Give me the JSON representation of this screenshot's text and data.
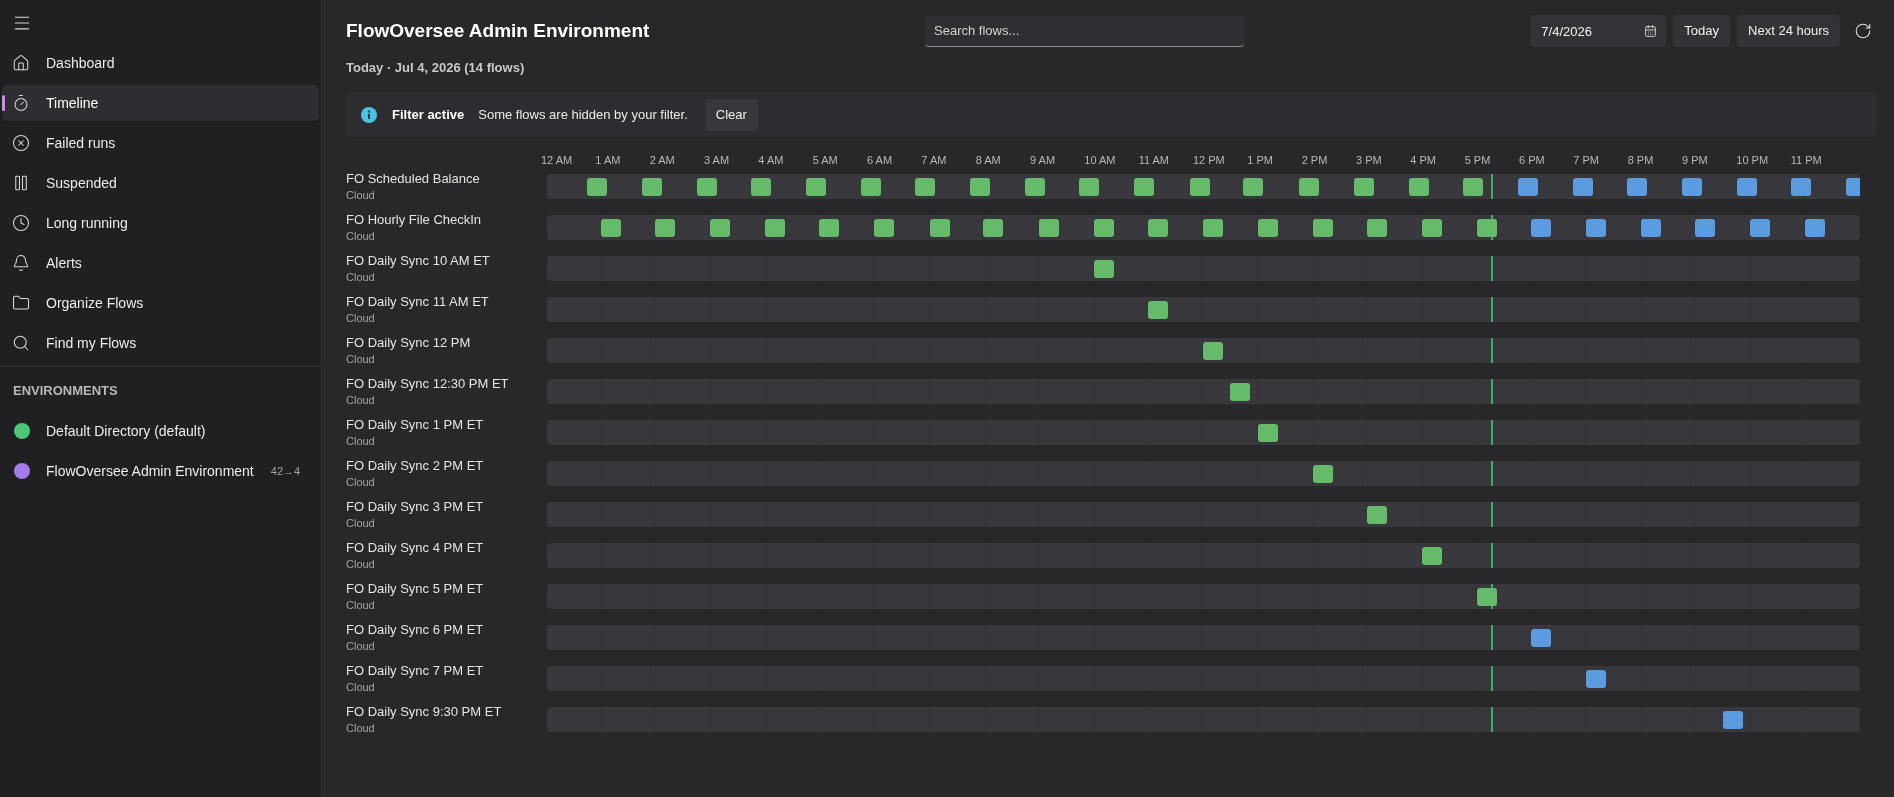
{
  "sidebar": {
    "nav_items": [
      {
        "label": "Dashboard",
        "selected": false
      },
      {
        "label": "Timeline",
        "selected": true
      },
      {
        "label": "Failed runs",
        "selected": false
      },
      {
        "label": "Suspended",
        "selected": false
      },
      {
        "label": "Long running",
        "selected": false
      },
      {
        "label": "Alerts",
        "selected": false
      },
      {
        "label": "Organize Flows",
        "selected": false
      },
      {
        "label": "Find my Flows",
        "selected": false
      }
    ],
    "section_title": "ENVIRONMENTS",
    "environments": [
      {
        "name": "Default Directory (default)",
        "color": "#4fc77a"
      },
      {
        "name": "FlowOversee Admin Environment",
        "color": "#a57bea",
        "badge": "42→4"
      }
    ]
  },
  "header": {
    "title": "FlowOversee Admin Environment",
    "search": {
      "placeholder": "Search flows..."
    },
    "date_field": {
      "value": "7/4/2026"
    },
    "buttons": [
      "Today",
      "Next 24 hours"
    ]
  },
  "subtitle": "Today · Jul 4, 2026 (14 flows)",
  "filter_banner": {
    "title": "Filter active",
    "message": "Some flows are hidden by your filter.",
    "button": "Clear"
  },
  "timeline": {
    "hours": [
      "12 AM",
      "1 AM",
      "2 AM",
      "3 AM",
      "4 AM",
      "5 AM",
      "6 AM",
      "7 AM",
      "8 AM",
      "9 AM",
      "10 AM",
      "11 AM",
      "12 PM",
      "1 PM",
      "2 PM",
      "3 PM",
      "4 PM",
      "5 PM",
      "6 PM",
      "7 PM",
      "8 PM",
      "9 PM",
      "10 PM",
      "11 PM"
    ],
    "now_line": {
      "level": 0.72
    },
    "flows": [
      {
        "name": "FO Scheduled Balance",
        "caption": "Cloud",
        "runs": [
          {
            "level": 0.038,
            "color": "#66bb6a"
          },
          {
            "level": 0.08,
            "color": "#66bb6a"
          },
          {
            "level": 0.122,
            "color": "#66bb6a"
          },
          {
            "level": 0.163,
            "color": "#66bb6a"
          },
          {
            "level": 0.205,
            "color": "#66bb6a"
          },
          {
            "level": 0.247,
            "color": "#66bb6a"
          },
          {
            "level": 0.288,
            "color": "#66bb6a"
          },
          {
            "level": 0.33,
            "color": "#66bb6a"
          },
          {
            "level": 0.372,
            "color": "#66bb6a"
          },
          {
            "level": 0.413,
            "color": "#66bb6a"
          },
          {
            "level": 0.455,
            "color": "#66bb6a"
          },
          {
            "level": 0.497,
            "color": "#66bb6a"
          },
          {
            "level": 0.538,
            "color": "#66bb6a"
          },
          {
            "level": 0.58,
            "color": "#66bb6a"
          },
          {
            "level": 0.622,
            "color": "#66bb6a"
          },
          {
            "level": 0.664,
            "color": "#66bb6a"
          },
          {
            "level": 0.705,
            "color": "#66bb6a"
          },
          {
            "level": 0.747,
            "color": "#5b9be0"
          },
          {
            "level": 0.789,
            "color": "#5b9be0"
          },
          {
            "level": 0.83,
            "color": "#5b9be0"
          },
          {
            "level": 0.872,
            "color": "#5b9be0"
          },
          {
            "level": 0.914,
            "color": "#5b9be0"
          },
          {
            "level": 0.955,
            "color": "#5b9be0"
          },
          {
            "level": 0.997,
            "color": "#5b9be0"
          }
        ]
      },
      {
        "name": "FO Hourly File CheckIn",
        "caption": "Cloud",
        "runs": [
          {
            "level": 0.049,
            "color": "#66bb6a"
          },
          {
            "level": 0.09,
            "color": "#66bb6a"
          },
          {
            "level": 0.132,
            "color": "#66bb6a"
          },
          {
            "level": 0.174,
            "color": "#66bb6a"
          },
          {
            "level": 0.215,
            "color": "#66bb6a"
          },
          {
            "level": 0.257,
            "color": "#66bb6a"
          },
          {
            "level": 0.299,
            "color": "#66bb6a"
          },
          {
            "level": 0.34,
            "color": "#66bb6a"
          },
          {
            "level": 0.382,
            "color": "#66bb6a"
          },
          {
            "level": 0.424,
            "color": "#66bb6a"
          },
          {
            "level": 0.465,
            "color": "#66bb6a"
          },
          {
            "level": 0.507,
            "color": "#66bb6a"
          },
          {
            "level": 0.549,
            "color": "#66bb6a"
          },
          {
            "level": 0.591,
            "color": "#66bb6a"
          },
          {
            "level": 0.632,
            "color": "#66bb6a"
          },
          {
            "level": 0.674,
            "color": "#66bb6a"
          },
          {
            "level": 0.716,
            "color": "#66bb6a"
          },
          {
            "level": 0.757,
            "color": "#5b9be0"
          },
          {
            "level": 0.799,
            "color": "#5b9be0"
          },
          {
            "level": 0.841,
            "color": "#5b9be0"
          },
          {
            "level": 0.882,
            "color": "#5b9be0"
          },
          {
            "level": 0.924,
            "color": "#5b9be0"
          },
          {
            "level": 0.966,
            "color": "#5b9be0"
          }
        ]
      },
      {
        "name": "FO Daily Sync 10 AM ET",
        "caption": "Cloud",
        "runs": [
          {
            "level": 0.424,
            "color": "#66bb6a"
          }
        ]
      },
      {
        "name": "FO Daily Sync 11 AM ET",
        "caption": "Cloud",
        "runs": [
          {
            "level": 0.465,
            "color": "#66bb6a"
          }
        ]
      },
      {
        "name": "FO Daily Sync 12 PM",
        "caption": "Cloud",
        "runs": [
          {
            "level": 0.507,
            "color": "#66bb6a"
          }
        ]
      },
      {
        "name": "FO Daily Sync 12:30 PM ET",
        "caption": "Cloud",
        "runs": [
          {
            "level": 0.528,
            "color": "#66bb6a"
          }
        ]
      },
      {
        "name": "FO Daily Sync 1 PM ET",
        "caption": "Cloud",
        "runs": [
          {
            "level": 0.549,
            "color": "#66bb6a"
          }
        ]
      },
      {
        "name": "FO Daily Sync 2 PM ET",
        "caption": "Cloud",
        "runs": [
          {
            "level": 0.591,
            "color": "#66bb6a"
          }
        ]
      },
      {
        "name": "FO Daily Sync 3 PM ET",
        "caption": "Cloud",
        "runs": [
          {
            "level": 0.632,
            "color": "#66bb6a"
          }
        ]
      },
      {
        "name": "FO Daily Sync 4 PM ET",
        "caption": "Cloud",
        "runs": [
          {
            "level": 0.674,
            "color": "#66bb6a"
          }
        ]
      },
      {
        "name": "FO Daily Sync 5 PM ET",
        "caption": "Cloud",
        "runs": [
          {
            "level": 0.716,
            "color": "#66bb6a"
          }
        ]
      },
      {
        "name": "FO Daily Sync 6 PM ET",
        "caption": "Cloud",
        "runs": [
          {
            "level": 0.757,
            "color": "#5b9be0"
          }
        ]
      },
      {
        "name": "FO Daily Sync 7 PM ET",
        "caption": "Cloud",
        "runs": [
          {
            "level": 0.799,
            "color": "#5b9be0"
          }
        ]
      },
      {
        "name": "FO Daily Sync 9:30 PM ET",
        "caption": "Cloud",
        "runs": [
          {
            "level": 0.903,
            "color": "#5b9be0"
          }
        ]
      }
    ]
  }
}
